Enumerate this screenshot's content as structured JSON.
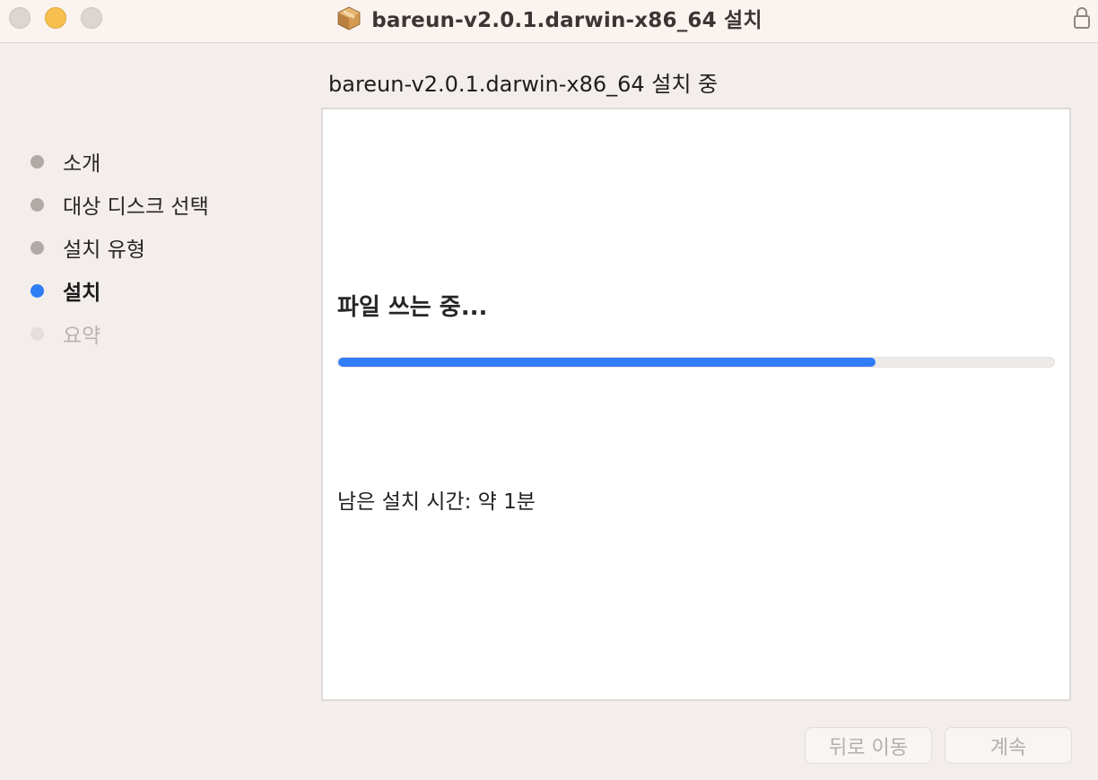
{
  "window": {
    "title": "bareun-v2.0.1.darwin-x86_64 설치"
  },
  "header": {
    "title": "bareun-v2.0.1.darwin-x86_64 설치 중"
  },
  "sidebar": {
    "steps": [
      {
        "label": "소개",
        "state": "done"
      },
      {
        "label": "대상 디스크 선택",
        "state": "done"
      },
      {
        "label": "설치 유형",
        "state": "done"
      },
      {
        "label": "설치",
        "state": "active"
      },
      {
        "label": "요약",
        "state": "pending"
      }
    ]
  },
  "content": {
    "status": "파일 쓰는 중...",
    "progress_percent": 75,
    "time_remaining": "남은 설치 시간: 약 1분"
  },
  "buttons": {
    "back_label": "뒤로 이동",
    "continue_label": "계속"
  },
  "colors": {
    "accent": "#2f7cf6",
    "minimize": "#f6bf4f"
  },
  "icons": {
    "title": "package-icon",
    "lock": "lock-icon"
  }
}
